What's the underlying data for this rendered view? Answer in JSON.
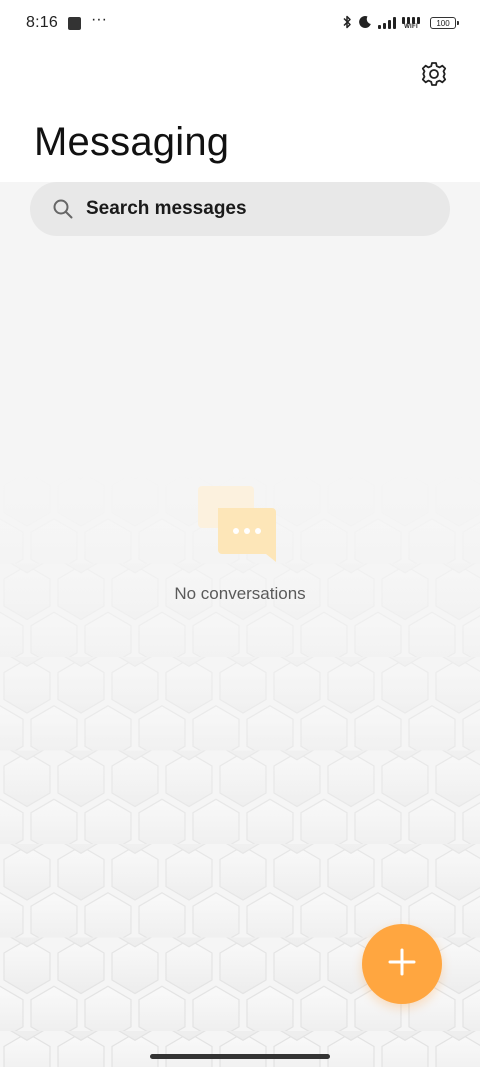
{
  "status_bar": {
    "time": "8:16",
    "wifi_label": "WIFI",
    "battery_level": "100",
    "icons": [
      "square-notification-icon",
      "more-dots-icon",
      "bluetooth-icon",
      "moon-icon",
      "signal-icon",
      "wifi-icon",
      "battery-icon"
    ]
  },
  "header": {
    "title": "Messaging",
    "settings_icon": "gear-icon"
  },
  "search": {
    "label": "Search messages",
    "icon": "search-icon"
  },
  "empty_state": {
    "message": "No conversations",
    "icon": "chat-bubble-icon"
  },
  "fab": {
    "icon": "plus-icon",
    "color": "#ffa640"
  },
  "colors": {
    "accent": "#ffa640",
    "background": "#f5f5f5",
    "search_bg": "#e8e8e8"
  }
}
